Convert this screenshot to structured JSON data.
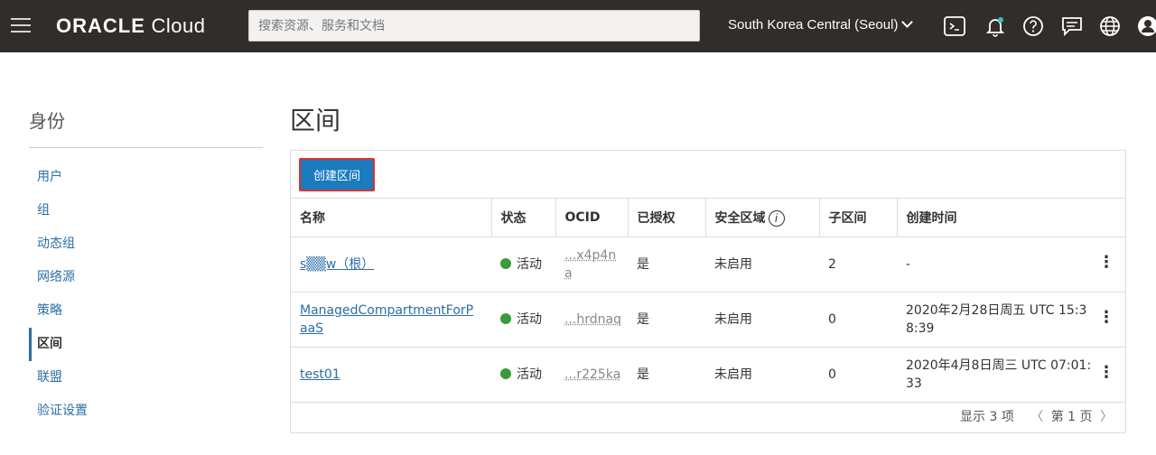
{
  "topbar": {
    "logo_brand": "ORACLE",
    "logo_product": "Cloud",
    "search_placeholder": "搜索资源、服务和文档",
    "region": "South Korea Central (Seoul)"
  },
  "sidebar": {
    "title": "身份",
    "items": [
      {
        "label": "用户"
      },
      {
        "label": "组"
      },
      {
        "label": "动态组"
      },
      {
        "label": "网络源"
      },
      {
        "label": "策略"
      },
      {
        "label": "区间"
      },
      {
        "label": "联盟"
      },
      {
        "label": "验证设置"
      }
    ]
  },
  "main": {
    "title": "区间",
    "create_label": "创建区间",
    "columns": {
      "name": "名称",
      "status": "状态",
      "ocid": "OCID",
      "authorized": "已授权",
      "security_zone": "安全区域",
      "children": "子区间",
      "created": "创建时间"
    },
    "rows": [
      {
        "name": "s▒▒w（根）",
        "status": "活动",
        "ocid": "...x4p4na",
        "authorized": "是",
        "security_zone": "未启用",
        "children": "2",
        "created": "-"
      },
      {
        "name": "ManagedCompartmentForPaaS",
        "status": "活动",
        "ocid": "...hrdnaq",
        "authorized": "是",
        "security_zone": "未启用",
        "children": "0",
        "created": "2020年2月28日周五 UTC 15:38:39"
      },
      {
        "name": "test01",
        "status": "活动",
        "ocid": "...r225ka",
        "authorized": "是",
        "security_zone": "未启用",
        "children": "0",
        "created": "2020年4月8日周三 UTC 07:01:33"
      }
    ],
    "footer_count": "显示 3 项",
    "footer_page": "第 1 页"
  },
  "colors": {
    "topbar": "#312d2a",
    "link": "#2a6ea6",
    "primary_button": "#1b7bbf",
    "active_status": "#3a9b3a"
  }
}
